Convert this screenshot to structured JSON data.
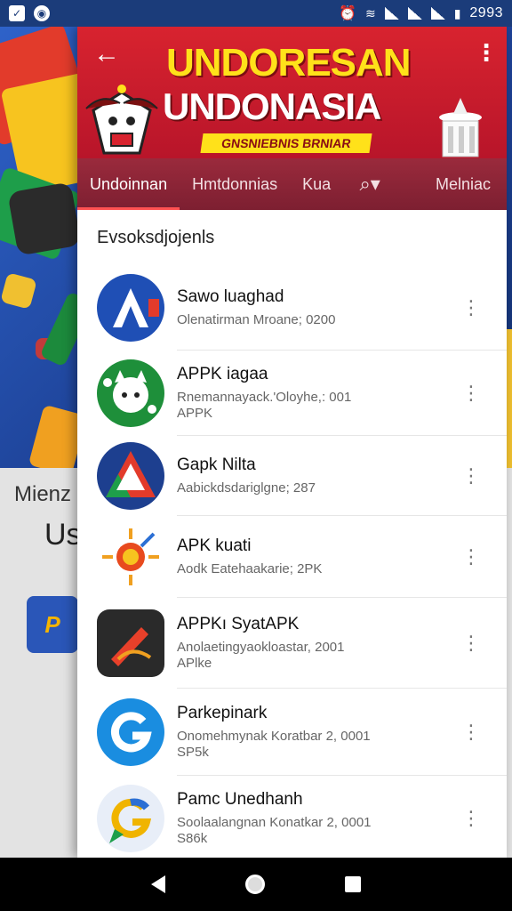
{
  "status_bar": {
    "time": "2993",
    "icons": [
      "notification-icon",
      "app-icon",
      "alarm-icon",
      "wifi-icon",
      "signal-icon",
      "signal-icon",
      "battery-icon"
    ]
  },
  "background": {
    "text_line1": "Mienz",
    "text_line2": "Us"
  },
  "banner": {
    "title_line1": "UNDORESAN",
    "title_line2": "UNDONASIA",
    "subtitle": "GNSNIEBNIS BRNIAR",
    "colors": {
      "bg": "#d8232f",
      "title": "#ffe11a"
    }
  },
  "tabs": [
    {
      "label": "Undoinnan",
      "active": true
    },
    {
      "label": "Hmtdonnias",
      "active": false
    },
    {
      "label": "Kua",
      "active": false
    },
    {
      "label": "",
      "icon": "search-icon"
    },
    {
      "label": "Melniac",
      "active": false
    }
  ],
  "section": {
    "title": "Evsoksdjojenls"
  },
  "apps": [
    {
      "title": "Sawo luaghad",
      "line1": "Olenatirman Mroane; 0200",
      "line2": "",
      "icon": "arrow-a-icon"
    },
    {
      "title": "APPK iagaa",
      "line1": "Rnemannayack.'Oloyhe,: 001",
      "line2": "APPK",
      "icon": "cat-icon"
    },
    {
      "title": "Gapk Nilta",
      "line1": "Aabickdsdariglgne; 287",
      "line2": "",
      "icon": "triangle-icon"
    },
    {
      "title": "APK kuati",
      "line1": "Aodk Eatehaakarie; 2PK",
      "line2": "",
      "icon": "sun-target-icon"
    },
    {
      "title": "APPKı SyatAPK",
      "line1": "Anolaetingyaokloastar, 2001",
      "line2": "APlke",
      "icon": "pen-icon"
    },
    {
      "title": "Parkepinark",
      "line1": "Onomehmynak Koratbar 2, 0001",
      "line2": "SP5k",
      "icon": "g-icon"
    },
    {
      "title": "Pamc Unedhanh",
      "line1": "Soolaalangnan Konatkar 2, 0001",
      "line2": "S86k",
      "icon": "g-chat-icon"
    }
  ]
}
